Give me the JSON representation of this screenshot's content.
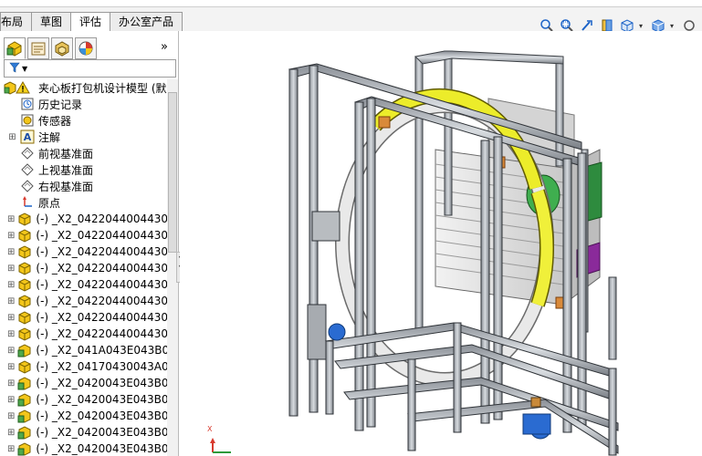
{
  "ribbon": {
    "tabs": [
      {
        "label": "布局",
        "active": false
      },
      {
        "label": "草图",
        "active": false
      },
      {
        "label": "评估",
        "active": true
      },
      {
        "label": "办公室产品",
        "active": false
      }
    ]
  },
  "view_toolbar": {
    "icons": [
      "zoom-to-fit-icon",
      "zoom-to-area-icon",
      "previous-view-icon",
      "section-view-icon",
      "view-orientation-icon",
      "display-style-icon",
      "more-icon"
    ],
    "accent": "#1b62c7"
  },
  "panel": {
    "tab_icons": [
      "feature-manager-icon",
      "property-manager-icon",
      "configuration-manager-icon",
      "display-manager-icon"
    ],
    "more_symbol": "»",
    "filter_symbol": "▼",
    "tree": {
      "root": {
        "label": "夹心板打包机设计模型  (默",
        "icon": "warning-assembly-icon"
      },
      "items": [
        {
          "label": "历史记录",
          "icon": "history-icon",
          "expandable": false
        },
        {
          "label": "传感器",
          "icon": "sensor-icon",
          "expandable": false
        },
        {
          "label": "注解",
          "icon": "annotation-icon",
          "expandable": true
        },
        {
          "label": "前视基准面",
          "icon": "plane-icon",
          "expandable": false
        },
        {
          "label": "上视基准面",
          "icon": "plane-icon",
          "expandable": false
        },
        {
          "label": "右视基准面",
          "icon": "plane-icon",
          "expandable": false
        },
        {
          "label": "原点",
          "icon": "origin-icon",
          "expandable": false
        },
        {
          "label": "(-) _X2_0422044004430",
          "icon": "part-icon",
          "expandable": true
        },
        {
          "label": "(-) _X2_0422044004430",
          "icon": "part-icon",
          "expandable": true
        },
        {
          "label": "(-) _X2_0422044004430",
          "icon": "part-icon",
          "expandable": true
        },
        {
          "label": "(-) _X2_0422044004430",
          "icon": "part-icon",
          "expandable": true
        },
        {
          "label": "(-) _X2_0422044004430",
          "icon": "part-icon",
          "expandable": true
        },
        {
          "label": "(-) _X2_0422044004430",
          "icon": "part-icon",
          "expandable": true
        },
        {
          "label": "(-) _X2_0422044004430",
          "icon": "part-icon",
          "expandable": true
        },
        {
          "label": "(-) _X2_0422044004430",
          "icon": "part-icon",
          "expandable": true
        },
        {
          "label": "(-) _X2_041A043E043B0",
          "icon": "assembly-icon",
          "expandable": true
        },
        {
          "label": "(-) _X2_04170430043A0",
          "icon": "part-icon",
          "expandable": true
        },
        {
          "label": "(-) _X2_0420043E043B0",
          "icon": "assembly-icon",
          "expandable": true
        },
        {
          "label": "(-) _X2_0420043E043B0",
          "icon": "assembly-icon",
          "expandable": true
        },
        {
          "label": "(-) _X2_0420043E043B0",
          "icon": "assembly-icon",
          "expandable": true
        },
        {
          "label": "(-) _X2_0420043E043B0",
          "icon": "assembly-icon",
          "expandable": true
        },
        {
          "label": "(-) _X2_0420043E043B0",
          "icon": "assembly-icon",
          "expandable": true
        }
      ]
    }
  },
  "triad": {
    "x_label": "X",
    "y_label": "Y"
  }
}
